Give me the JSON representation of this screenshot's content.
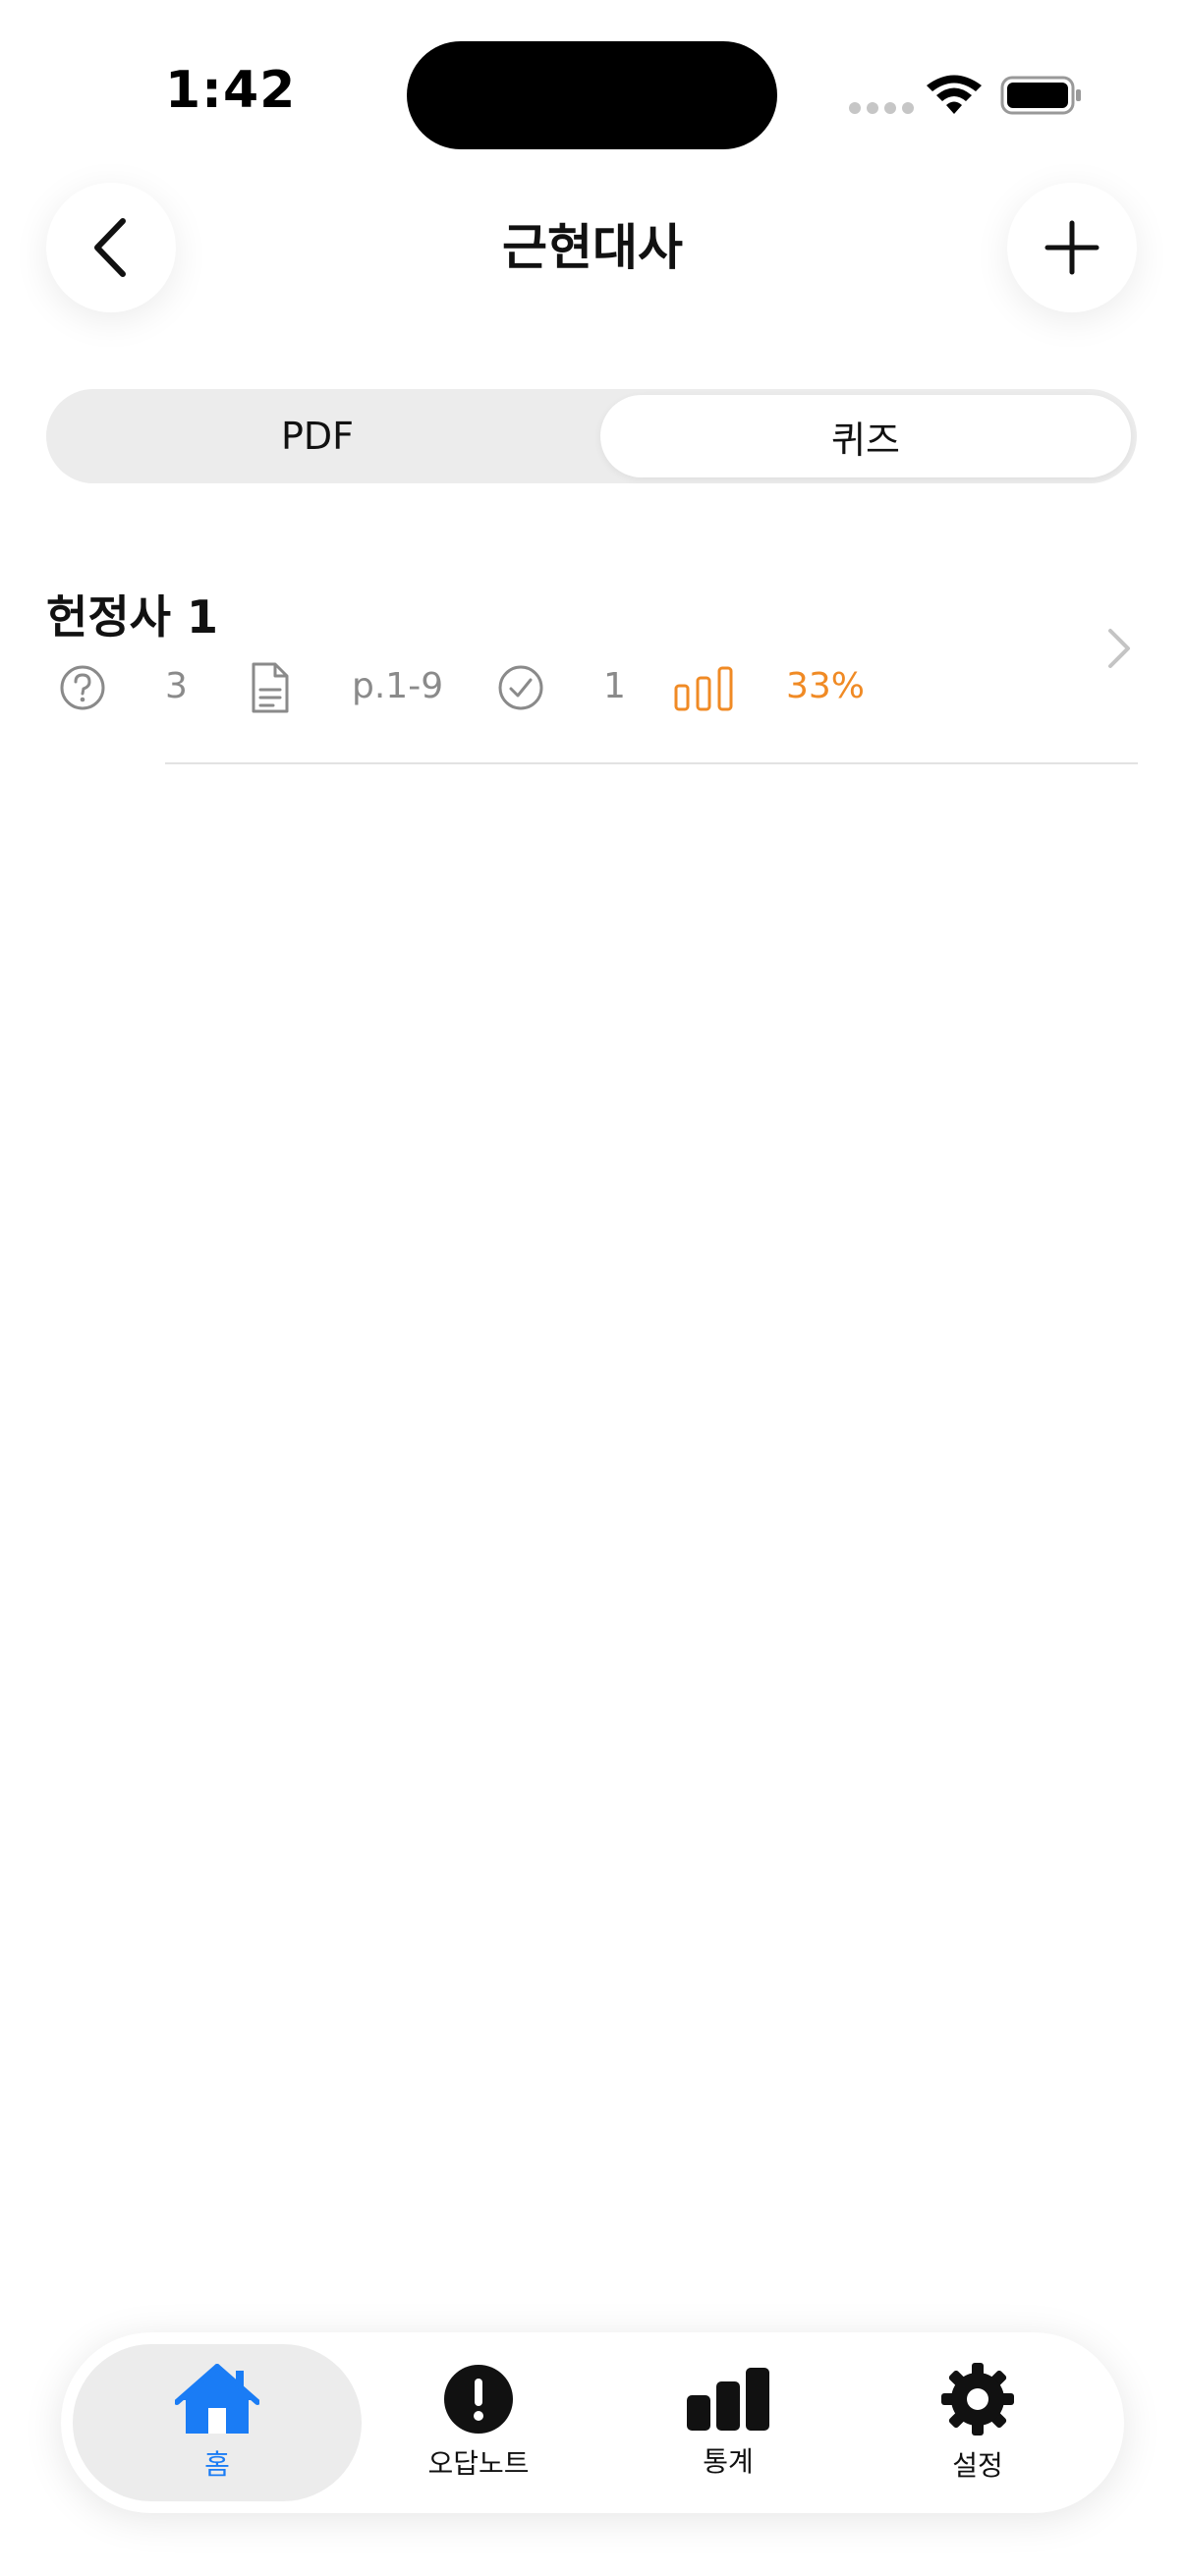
{
  "status_bar": {
    "time": "1:42"
  },
  "header": {
    "title": "근현대사"
  },
  "segments": [
    {
      "label": "PDF",
      "selected": false
    },
    {
      "label": "퀴즈",
      "selected": true
    }
  ],
  "item": {
    "title": "헌정사 1",
    "question_count": "3",
    "pages": "p.1-9",
    "correct_count": "1",
    "score": "33%"
  },
  "tabbar": {
    "tabs": [
      {
        "label": "홈",
        "icon": "house-icon",
        "active": true
      },
      {
        "label": "오답노트",
        "icon": "exclamation-circle-icon",
        "active": false
      },
      {
        "label": "통계",
        "icon": "bar-chart-icon",
        "active": false
      },
      {
        "label": "설정",
        "icon": "gear-icon",
        "active": false
      }
    ]
  },
  "colors": {
    "accent": "#1a7cf5",
    "score": "#f08a24",
    "secondary_text": "#8a8a8a"
  }
}
